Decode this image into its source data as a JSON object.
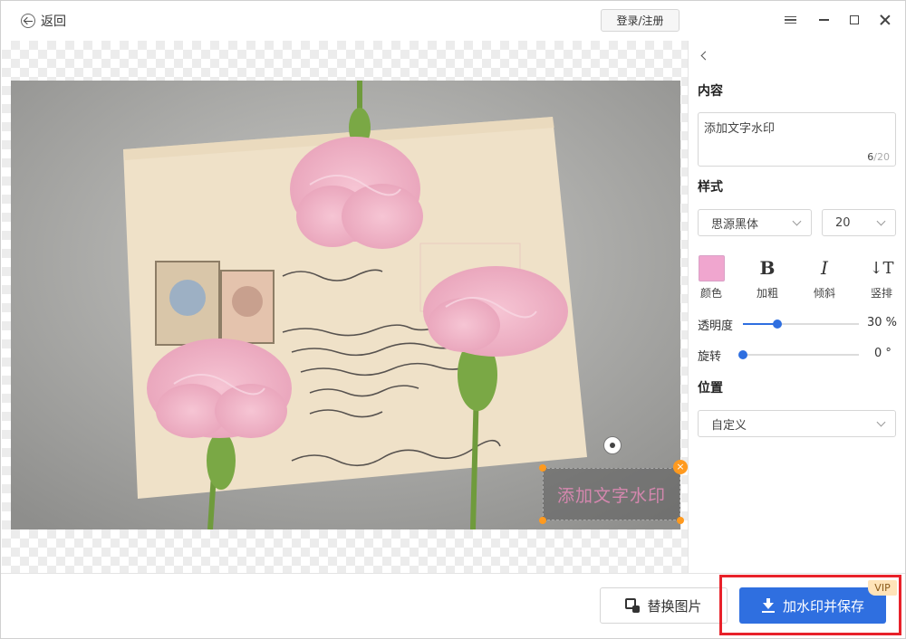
{
  "header": {
    "back_label": "返回",
    "login_label": "登录/注册"
  },
  "canvas": {
    "watermark_text": "添加文字水印",
    "watermark_color": "#e58bb9",
    "close_glyph": "×"
  },
  "panel": {
    "content_title": "内容",
    "content_value": "添加文字水印",
    "char_count": "6",
    "char_max": "/20",
    "style_title": "样式",
    "font_family": "思源黑体",
    "font_size": "20",
    "tools": {
      "color_label": "颜色",
      "color_value": "#f0a6cf",
      "bold_glyph": "B",
      "bold_label": "加粗",
      "italic_glyph": "I",
      "italic_label": "倾斜",
      "vertical_glyph": "↓T",
      "vertical_label": "竖排"
    },
    "opacity": {
      "label": "透明度",
      "value_text": "30 %",
      "value": 0.3
    },
    "rotation": {
      "label": "旋转",
      "value_text": "0 °",
      "value": 0
    },
    "position_title": "位置",
    "position_value": "自定义"
  },
  "footer": {
    "replace_label": "替换图片",
    "save_label": "加水印并保存",
    "vip_badge": "VIP"
  },
  "colors": {
    "accent": "#2f6fe0",
    "highlight_border": "#e8212a",
    "handle": "#ff9a1f"
  }
}
